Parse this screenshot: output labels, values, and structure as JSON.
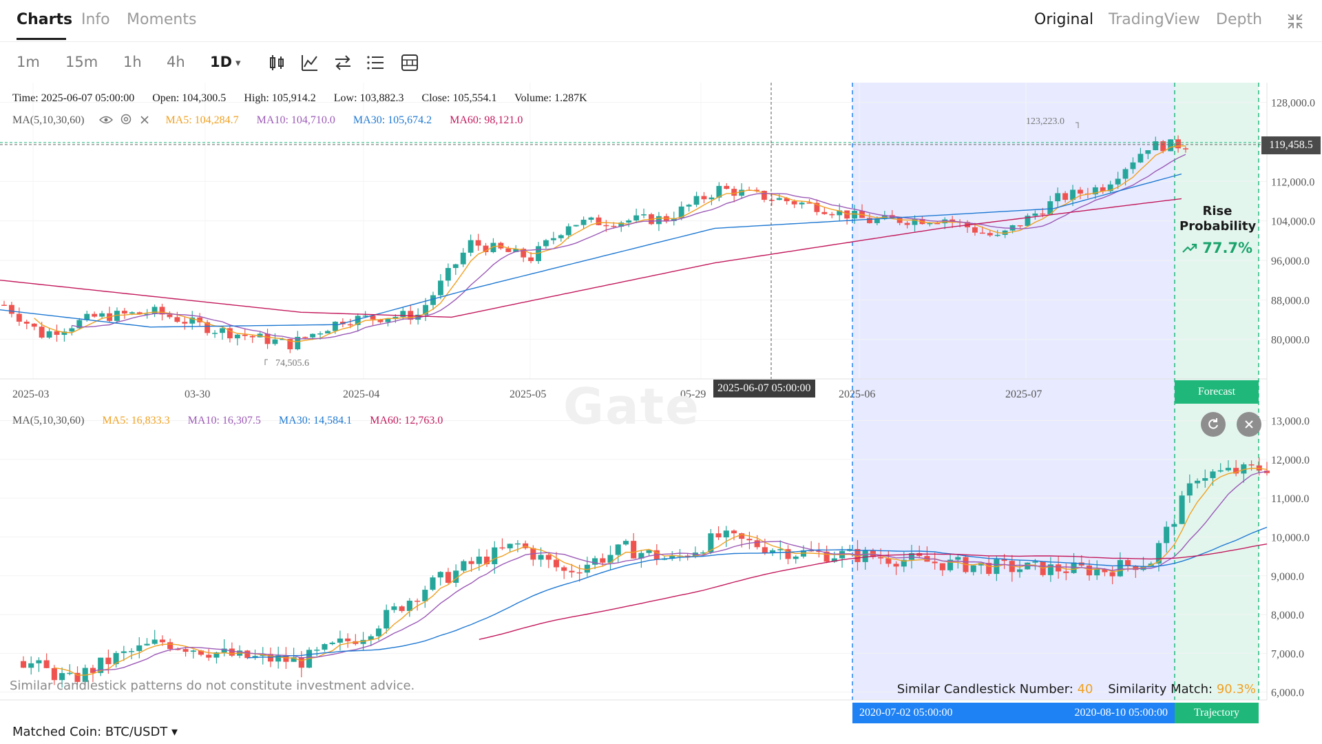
{
  "tabs": [
    {
      "label": "Charts",
      "active": true
    },
    {
      "label": "Info",
      "active": false
    },
    {
      "label": "Moments",
      "active": false
    }
  ],
  "views": [
    {
      "label": "Original",
      "active": true
    },
    {
      "label": "TradingView",
      "active": false
    },
    {
      "label": "Depth",
      "active": false
    }
  ],
  "icons": {
    "collapse": "collapse-icon",
    "eye": "eye-icon",
    "settings": "settings-icon",
    "close": "close-icon",
    "trend_up": "trend-up-icon",
    "refresh": "refresh-icon"
  },
  "timeframes": [
    {
      "label": "1m",
      "active": false
    },
    {
      "label": "15m",
      "active": false
    },
    {
      "label": "1h",
      "active": false
    },
    {
      "label": "4h",
      "active": false
    },
    {
      "label": "1D",
      "active": true
    }
  ],
  "timeframe_dropdown": "▾",
  "tools": [
    "candlestick-icon",
    "indicator-icon",
    "compare-icon",
    "list-icon",
    "layout-icon"
  ],
  "ohlc": {
    "time": "Time: 2025-06-07 05:00:00",
    "open": "Open: 104,300.5",
    "high": "High: 105,914.2",
    "low": "Low: 103,882.3",
    "close": "Close: 105,554.1",
    "volume": "Volume: 1.287K"
  },
  "main_ma": {
    "label": "MA(5,10,30,60)",
    "ma5": "MA5: 104,284.7",
    "ma10": "MA10: 104,710.0",
    "ma30": "MA30: 105,674.2",
    "ma60": "MA60: 98,121.0"
  },
  "sub_ma": {
    "label": "MA(5,10,30,60)",
    "ma5": "MA5: 16,833.3",
    "ma10": "MA10: 16,307.5",
    "ma30": "MA30: 14,584.1",
    "ma60": "MA60: 12,763.0"
  },
  "colors": {
    "up": "#26a69a",
    "down": "#ef5350",
    "ma5": "#f0a020",
    "ma10": "#9b59b6",
    "ma30": "#1e78d2",
    "ma60": "#c2185b",
    "highlight_blue": "#e8ebff",
    "highlight_green": "#e3f6ee"
  },
  "chart_data": [
    {
      "type": "candlestick",
      "title": "",
      "y_ticks": [
        "128,000.0",
        "112,000.0",
        "104,000.0",
        "96,000.0",
        "88,000.0",
        "80,000.0"
      ],
      "x_ticks": [
        "2025-03",
        "03-30",
        "2025-04",
        "2025-05",
        "05-29",
        "2025-06",
        "2025-07"
      ],
      "ylim": [
        72000,
        132000
      ],
      "current_price": "119,458.5",
      "max_label": "123,223.0",
      "min_label": "74,505.6",
      "crosshair_time": "2025-06-07 05:00:00",
      "legend": "top-left",
      "grid": true
    },
    {
      "type": "candlestick",
      "title": "",
      "y_ticks": [
        "13,000.0",
        "12,000.0",
        "11,000.0",
        "10,000.0",
        "9,000.0",
        "8,000.0",
        "7,000.0",
        "6,000.0"
      ],
      "ylim": [
        5800,
        13400
      ],
      "legend": "top-left",
      "grid": true
    }
  ],
  "overlay": {
    "rise_title": "Rise Probability",
    "rise_value": "77.7%",
    "forecast_label": "Forecast",
    "trajectory_label": "Trajectory",
    "range_start": "2020-07-02 05:00:00",
    "range_end": "2020-08-10 05:00:00"
  },
  "watermark": "Gate",
  "footer": {
    "disclaimer": "Similar candlestick patterns do not constitute investment advice.",
    "similar_label": "Similar Candlestick Number:",
    "similar_value": "40",
    "match_label": "Similarity Match:",
    "match_value": "90.3%",
    "matched_coin": "Matched Coin: BTC/USDT ▾"
  }
}
